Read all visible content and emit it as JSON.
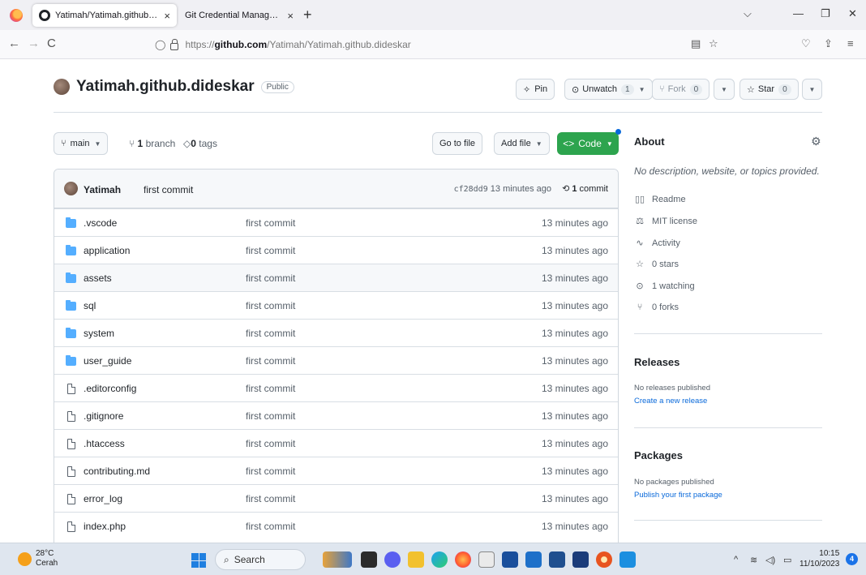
{
  "browser": {
    "tabs": [
      {
        "title": "Yatimah/Yatimah.github.didesk",
        "close": "×"
      },
      {
        "title": "Git Credential Manager - Authentic",
        "close": "×"
      }
    ],
    "new_tab": "+",
    "window_controls": {
      "list": "⌵",
      "minimize": "—",
      "maximize": "❐",
      "close": "✕"
    },
    "nav": {
      "back": "←",
      "forward": "→",
      "reload": "C"
    },
    "url": {
      "protocol": "https://",
      "host": "github.com",
      "path": "/Yatimah/Yatimah.github.dideskar"
    },
    "toolbar_icons": {
      "reader": "▤",
      "bookmark": "☆",
      "pocket": "♡",
      "share": "⇪",
      "menu": "≡"
    }
  },
  "repo": {
    "name": "Yatimah.github.dideskar",
    "visibility": "Public",
    "pin_label": "Pin",
    "unwatch_label": "Unwatch",
    "unwatch_count": "1",
    "fork_label": "Fork",
    "fork_count": "0",
    "star_label": "Star",
    "star_count": "0"
  },
  "toolbar": {
    "branch": "main",
    "branches_count": "1",
    "branches_label": "branch",
    "tags_count": "0",
    "tags_label": "tags",
    "goto_file": "Go to file",
    "add_file": "Add file",
    "code": "Code"
  },
  "commit": {
    "author": "Yatimah",
    "message": "first commit",
    "hash": "cf28dd9",
    "time": "13 minutes ago",
    "count": "1",
    "count_label": "commit"
  },
  "files": [
    {
      "name": ".vscode",
      "type": "dir",
      "message": "first commit",
      "time": "13 minutes ago"
    },
    {
      "name": "application",
      "type": "dir",
      "message": "first commit",
      "time": "13 minutes ago"
    },
    {
      "name": "assets",
      "type": "dir",
      "message": "first commit",
      "time": "13 minutes ago"
    },
    {
      "name": "sql",
      "type": "dir",
      "message": "first commit",
      "time": "13 minutes ago"
    },
    {
      "name": "system",
      "type": "dir",
      "message": "first commit",
      "time": "13 minutes ago"
    },
    {
      "name": "user_guide",
      "type": "dir",
      "message": "first commit",
      "time": "13 minutes ago"
    },
    {
      "name": ".editorconfig",
      "type": "file",
      "message": "first commit",
      "time": "13 minutes ago"
    },
    {
      "name": ".gitignore",
      "type": "file",
      "message": "first commit",
      "time": "13 minutes ago"
    },
    {
      "name": ".htaccess",
      "type": "file",
      "message": "first commit",
      "time": "13 minutes ago"
    },
    {
      "name": "contributing.md",
      "type": "file",
      "message": "first commit",
      "time": "13 minutes ago"
    },
    {
      "name": "error_log",
      "type": "file",
      "message": "first commit",
      "time": "13 minutes ago"
    },
    {
      "name": "index.php",
      "type": "file",
      "message": "first commit",
      "time": "13 minutes ago"
    }
  ],
  "about": {
    "title": "About",
    "description": "No description, website, or topics provided.",
    "stats": [
      {
        "icon": "book-icon",
        "label": "Readme"
      },
      {
        "icon": "law-icon",
        "label": "MIT license"
      },
      {
        "icon": "pulse-icon",
        "label": "Activity"
      },
      {
        "icon": "star-icon",
        "label": "0 stars"
      },
      {
        "icon": "eye-icon",
        "label": "1 watching"
      },
      {
        "icon": "fork-icon",
        "label": "0 forks"
      }
    ]
  },
  "releases": {
    "title": "Releases",
    "note": "No releases published",
    "link": "Create a new release"
  },
  "packages": {
    "title": "Packages",
    "note": "No packages published",
    "link": "Publish your first package"
  },
  "taskbar": {
    "temperature": "28°C",
    "weather": "Cerah",
    "search": "Search",
    "time": "10:15",
    "date": "11/10/2023",
    "notifications": "4",
    "tray": {
      "chevron": "^",
      "wifi": "≋",
      "sound": "◁)",
      "battery": "▭"
    }
  },
  "colors": {
    "accent_green": "#2da44e",
    "link_blue": "#0969da",
    "folder_blue": "#54aeff"
  }
}
